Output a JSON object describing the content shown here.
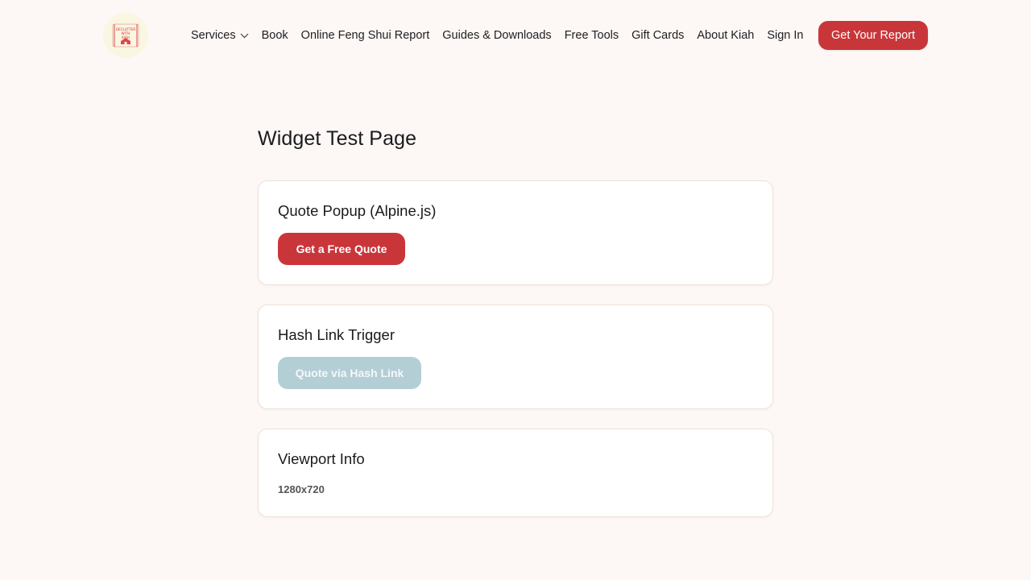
{
  "header": {
    "logo": {
      "text_lines": [
        "DECLUTTER",
        "WITH",
        "KIAH"
      ],
      "icon": "house-icon"
    },
    "nav": [
      {
        "label": "Services",
        "has_dropdown": true
      },
      {
        "label": "Book"
      },
      {
        "label": "Online Feng Shui Report"
      },
      {
        "label": "Guides & Downloads"
      },
      {
        "label": "Free Tools"
      },
      {
        "label": "Gift Cards"
      },
      {
        "label": "About Kiah"
      },
      {
        "label": "Sign In"
      }
    ],
    "cta_label": "Get Your Report"
  },
  "main": {
    "title": "Widget Test Page",
    "cards": [
      {
        "title": "Quote Popup (Alpine.js)",
        "button_label": "Get a Free Quote"
      },
      {
        "title": "Hash Link Trigger",
        "button_label": "Quote via Hash Link"
      },
      {
        "title": "Viewport Info",
        "value": "1280x720"
      }
    ]
  },
  "colors": {
    "background": "#fdf7f6",
    "accent": "#c9363a",
    "muted_button": "#b4ced5",
    "card_border": "#ece3d8"
  }
}
